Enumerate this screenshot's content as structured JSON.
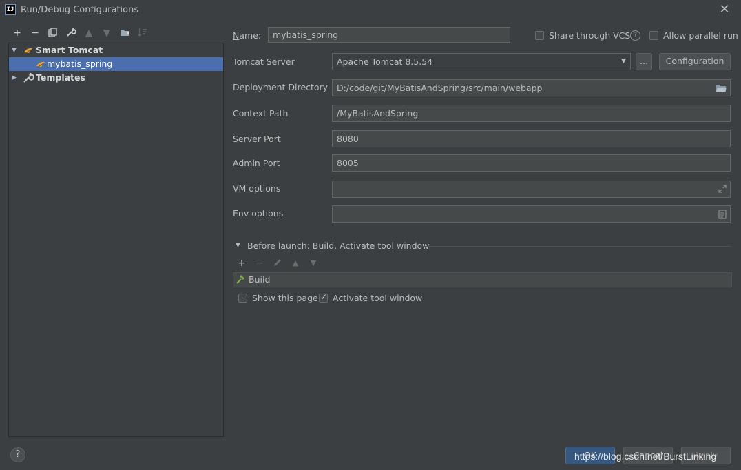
{
  "window": {
    "title": "Run/Debug Configurations",
    "app_icon": "IJ"
  },
  "toolbar": {
    "icons": [
      "add-icon",
      "remove-icon",
      "copy-icon",
      "wrench-icon",
      "move-up-icon",
      "move-down-icon",
      "folder-add-icon",
      "sort-icon"
    ]
  },
  "tree": {
    "group": "Smart Tomcat",
    "child": "mybatis_spring",
    "templates": "Templates"
  },
  "form": {
    "name_label": "Name:",
    "name_value": "mybatis_spring",
    "share_vcs": "Share through VCS",
    "allow_parallel": "Allow parallel run",
    "tomcat_label": "Tomcat Server",
    "tomcat_value": "Apache Tomcat 8.5.54",
    "ellipsis": "...",
    "configuration": "Configuration",
    "deploy_label": "Deployment Directory",
    "deploy_value": "D:/code/git/MyBatisAndSpring/src/main/webapp",
    "context_label": "Context Path",
    "context_value": "/MyBatisAndSpring",
    "server_port_label": "Server Port",
    "server_port_value": "8080",
    "admin_port_label": "Admin Port",
    "admin_port_value": "8005",
    "vm_label": "VM options",
    "vm_value": "",
    "env_label": "Env options",
    "env_value": ""
  },
  "before_launch": {
    "title": "Before launch: Build, Activate tool window",
    "task": "Build",
    "show_page": "Show this page",
    "activate": "Activate tool window",
    "show_page_checked": false,
    "activate_checked": true
  },
  "footer": {
    "help": "?",
    "ok": "OK",
    "cancel": "Cancel",
    "apply": "Apply",
    "watermark": "https://blog.csdn.net/BurstLinking"
  },
  "colors": {
    "background": "#3c3f41",
    "selection": "#4b6eaf",
    "field": "#45494a",
    "ok_button": "#365880"
  }
}
